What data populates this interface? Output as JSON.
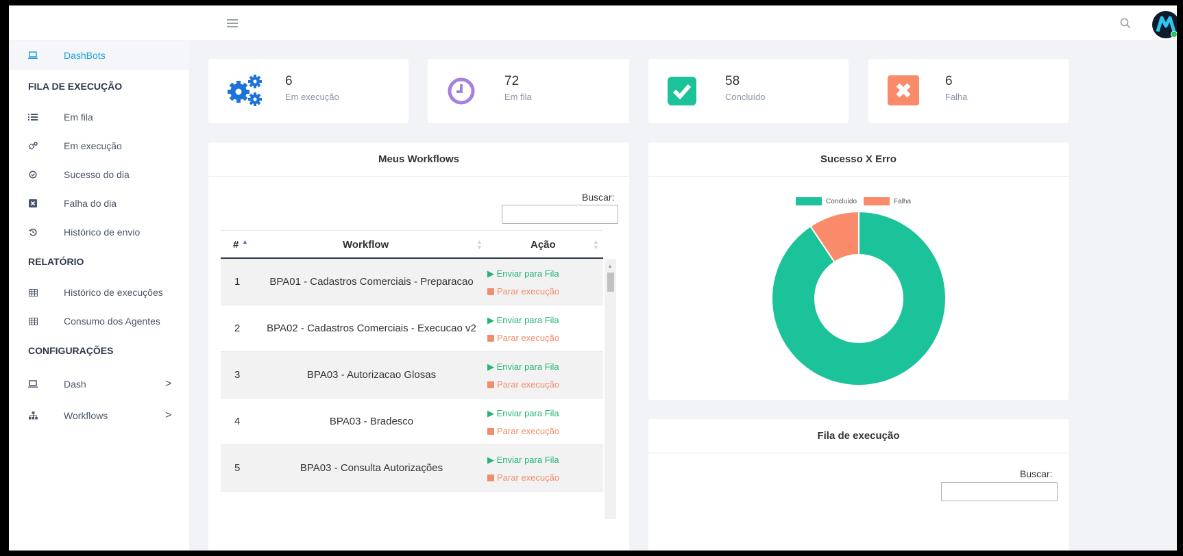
{
  "topbar": {
    "menu_icon": "hamburger-icon",
    "search_icon": "search-icon",
    "avatar_letter": "M"
  },
  "sidebar": {
    "active": {
      "label": "DashBots",
      "icon": "laptop-icon"
    },
    "sections": [
      {
        "title": "FILA DE EXECUÇÃO"
      },
      {
        "title": "RELATÓRIO"
      },
      {
        "title": "CONFIGURAÇÕES"
      }
    ],
    "items": [
      {
        "label": "Em fila",
        "icon": "list-icon"
      },
      {
        "label": "Em execução",
        "icon": "cogs-icon"
      },
      {
        "label": "Sucesso do dia",
        "icon": "check-circle-icon"
      },
      {
        "label": "Falha do dia",
        "icon": "x-square-icon"
      },
      {
        "label": "Histórico de envio",
        "icon": "history-icon"
      },
      {
        "label": "Histórico de execuções",
        "icon": "table-icon"
      },
      {
        "label": "Consumo dos Agentes",
        "icon": "table-icon"
      },
      {
        "label": "Dash",
        "icon": "laptop-icon",
        "chevron": ">"
      },
      {
        "label": "Workflows",
        "icon": "sitemap-icon",
        "chevron": ">"
      }
    ]
  },
  "stats": [
    {
      "value": "6",
      "label": "Em execução",
      "icon": "cogs-icon",
      "color": "#1e73d8"
    },
    {
      "value": "72",
      "label": "Em fila",
      "icon": "clock-icon",
      "color": "#a77fe0"
    },
    {
      "value": "58",
      "label": "Concluído",
      "icon": "check-square-icon",
      "color": "#1cc29a"
    },
    {
      "value": "6",
      "label": "Falha",
      "icon": "x-square-icon",
      "color": "#f98b6a"
    }
  ],
  "workflows": {
    "title": "Meus Workflows",
    "search_label": "Buscar:",
    "columns": [
      "#",
      "Workflow",
      "Ação"
    ],
    "send_label": "Enviar para Fila",
    "stop_label": "Parar execução",
    "rows": [
      {
        "id": "1",
        "name": "BPA01 - Cadastros Comerciais - Preparacao"
      },
      {
        "id": "2",
        "name": "BPA02 - Cadastros Comerciais - Execucao v2"
      },
      {
        "id": "3",
        "name": "BPA03 - Autorizacao Glosas"
      },
      {
        "id": "4",
        "name": "BPA03 - Bradesco"
      },
      {
        "id": "5",
        "name": "BPA03 - Consulta Autorizações"
      }
    ]
  },
  "chart_data": {
    "type": "pie",
    "title": "Sucesso X Erro",
    "categories": [
      "Concluído",
      "Falha"
    ],
    "values": [
      58,
      6
    ],
    "colors": [
      "#1cc29a",
      "#f98b6a"
    ],
    "donut": true,
    "legend_position": "top"
  },
  "queue": {
    "title": "Fila de execução",
    "search_label": "Buscar:"
  }
}
